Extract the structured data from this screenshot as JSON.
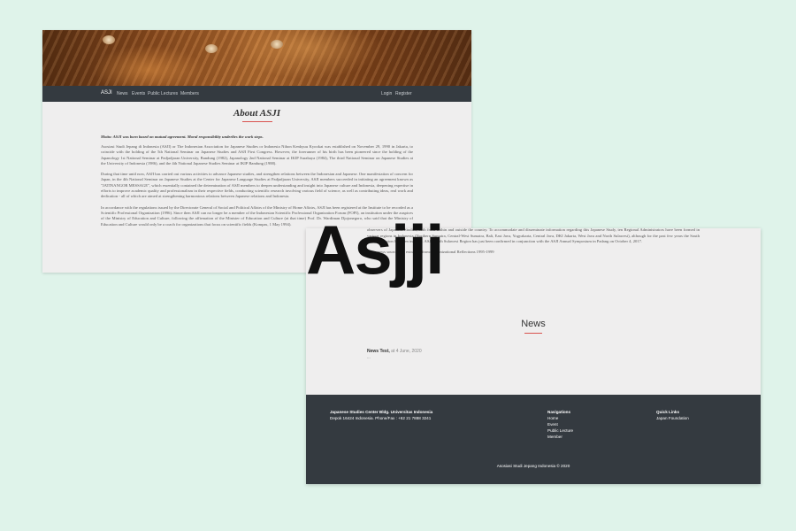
{
  "site": {
    "brand": "ASJI",
    "nav": [
      "News",
      "Events",
      "Public Lectures",
      "Members"
    ],
    "auth": [
      "Login",
      "Register"
    ]
  },
  "about": {
    "title": "About ASJI",
    "motto": "Motto: ASJI was born based on mutual agreement. Moral responsibility underlies the work steps.",
    "p1": "Asosiasi Studi Jepang di Indonesia (ASJI) or The Indonesian Association for Japanese Studies or Indonesia Nihon Kenkyuu Kyookai was established on November 29, 1990 in Jakarta, to coincide with the holding of the 5th National Seminar on Japanese Studies and ASJI First Congress. However, the forerunner of his birth has been pioneered since the holding of the Japanology 1st National Seminar at Padjadjaran University, Bandung (1982), Japanology 2nd National Seminar at IKIP Surabaya (1984), The third National Seminar on Japanese Studies at the University of Indonesia (1986), and the 4th National Japanese Studies Seminar at IKIP Bandung (1988).",
    "p2": "During that time until now, ASJI has carried out various activities to advance Japanese studies, and strengthen relations between the Indonesian and Japanese. One manifestation of concern for Japan, in the 4th National Seminar on Japanese Studies at the Center for Japanese Language Studies at Padjadjaran University, ASJI members succeeded in initiating an agreement known as \"JATINANGOR MESSAGE\", which essentially contained the determination of ASJI members to deepen understanding and insight into Japanese culture and Indonesia, deepening expertise in efforts to improve academic quality and professionalism in their respective fields, conducting scientific research involving various field of science, as well as contributing ideas, real work and dedication - all of which are aimed at strengthening harmonious relations between Japanese relations and Indonesia.",
    "p3": "In accordance with the regulations issued by the Directorate General of Social and Political Affairs of the Ministry of Home Affairs, ASJI has been registered at the Institute to be recorded as a Scientific Professional Organization (1996). Since then ASJI can no longer be a member of the Indonesian Scientific Professional Organization Forum (FOPI), an institution under the auspices of the Ministry of Education and Culture, following the affirmation of the Minister of Education and Culture (at that time) Prof. Dr. Wardiman Djojonegoro, who said that the Ministry of Education and Culture would only be a coach for organizations that focus on scientific fields (Kompas, 1 May 1994).",
    "p4": "Under the leadership of Mr. Bachtiar Alam, Ph. D the word kyookai in Indonesia Nihon Kenkyuu Kyookai changed to Indonesia Nihon Gakkai. At the age of 28th, ASJI has received broad responses from observers of Japanese Studies, both from within and outside the country. To accommodate and disseminate information regarding this Japanese Study, ten Regional Administrators have been formed in various regions in Indonesia (Northern Sumatra, Central-West Sumatra, Bali, East Java, Yogyakarta, Central Java, DKI Jakarta, West Java and North Sulawesi), although for the past few years the South Sumatra Region has been inactive. ASJI South Sulawesi Region has just been confirmed in conjunction with the ASJI Annual Symposium in Padang on October 4, 2017.",
    "p5": "Some news sources are extracted from: Organizational Reflections 1995-1999"
  },
  "news": {
    "title": "News",
    "item_title": "News Test,",
    "item_date": "at 4 June, 2020",
    "item_more": "..."
  },
  "footer": {
    "org": "Japanese Studies Center Bldg. Universitas Indonesia",
    "address": "Depok 16424 Indonesia. Phone/Fax : +62 21 7888 3241",
    "nav_heading": "Navigations",
    "nav_items": [
      "Home",
      "Event",
      "Public Lecture",
      "Member"
    ],
    "quick_heading": "Quick Links",
    "quick_items": [
      "Japan Foundation"
    ],
    "copyright": "Asosiasi Studi Jepang Indonesia © 2020"
  },
  "logo_text": "Asjji",
  "colors": {
    "background": "#dff3ea",
    "navbar": "#343a40",
    "accent": "#d9534f",
    "page": "#efeeee"
  }
}
